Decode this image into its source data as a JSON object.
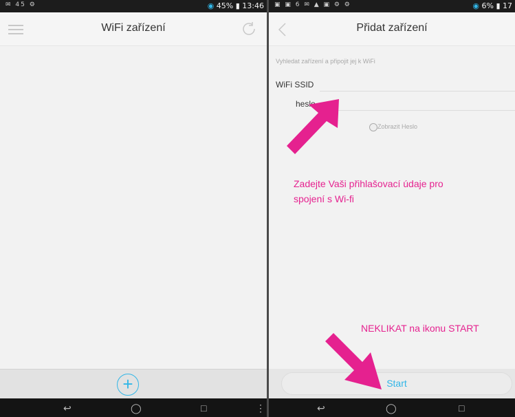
{
  "left_screen": {
    "status_left": "✉ 45 ⚙",
    "status_right": "45%",
    "status_time": "13:46",
    "title": "WiFi zařízení",
    "add_button": "+"
  },
  "right_screen": {
    "status_left": "▣ ▣ 6 ✉ ▲ ▣ ⚙ ⚙",
    "status_right": "6%",
    "status_time": "17",
    "title": "Přidat zařízení",
    "hint": "Vyhledat zařízení a připojit jej k WiFi",
    "ssid_label": "WiFi SSID",
    "ssid_value": "",
    "password_label": "heslo",
    "password_value": "",
    "show_password_label": "Zobrazit Heslo",
    "start_button": "Start"
  },
  "annotations": {
    "credentials_line1": "Zadejte Vaši přihlašovací údaje pro",
    "credentials_line2": "spojení s Wi-fi",
    "start_note": "NEKLIKAT na ikonu START"
  },
  "colors": {
    "accent": "#31b6e7",
    "annotation": "#e5218f",
    "status_bar": "#1c1c1c",
    "nav_bar": "#141414"
  },
  "icons": [
    "menu-icon",
    "refresh-icon",
    "back-icon",
    "add-icon",
    "back-nav-icon",
    "home-nav-icon",
    "recent-apps-icon"
  ]
}
